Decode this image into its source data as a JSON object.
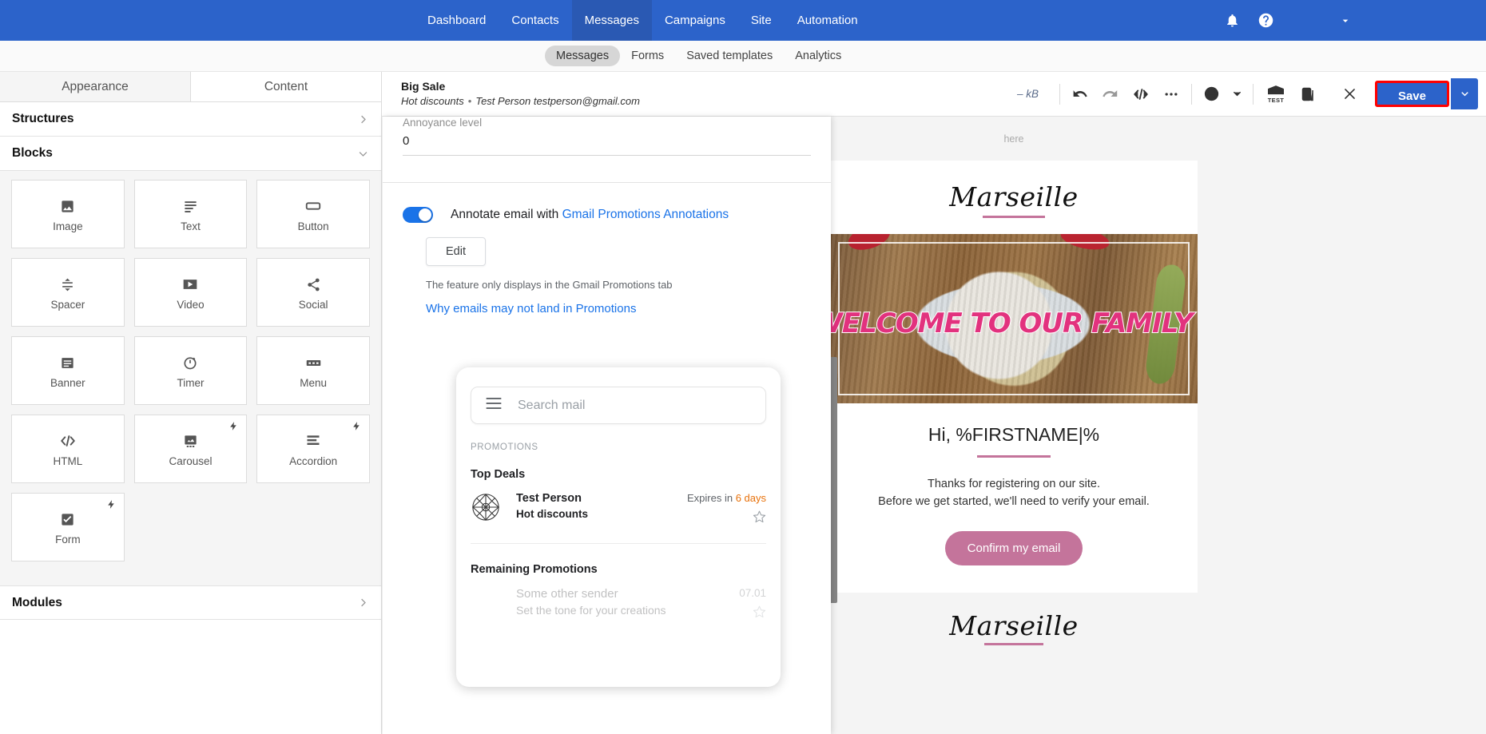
{
  "topnav": {
    "links": [
      {
        "label": "Dashboard",
        "active": false
      },
      {
        "label": "Contacts",
        "active": false
      },
      {
        "label": "Messages",
        "active": true
      },
      {
        "label": "Campaigns",
        "active": false
      },
      {
        "label": "Site",
        "active": false
      },
      {
        "label": "Automation",
        "active": false
      }
    ],
    "icons": [
      "bell-icon",
      "help-icon",
      "account-chevron-icon"
    ]
  },
  "subnav": {
    "tabs": [
      {
        "label": "Messages",
        "active": true
      },
      {
        "label": "Forms",
        "active": false
      },
      {
        "label": "Saved templates",
        "active": false
      },
      {
        "label": "Analytics",
        "active": false
      }
    ]
  },
  "sidebar": {
    "tabs": [
      {
        "label": "Appearance",
        "active": true
      },
      {
        "label": "Content",
        "active": false
      }
    ],
    "sections": [
      {
        "title": "Structures",
        "expanded": false
      },
      {
        "title": "Blocks",
        "expanded": true
      },
      {
        "title": "Modules",
        "expanded": false
      }
    ],
    "blocks": [
      {
        "label": "Image",
        "icon": "image-icon",
        "pro": false
      },
      {
        "label": "Text",
        "icon": "text-icon",
        "pro": false
      },
      {
        "label": "Button",
        "icon": "button-icon",
        "pro": false
      },
      {
        "label": "Spacer",
        "icon": "spacer-icon",
        "pro": false
      },
      {
        "label": "Video",
        "icon": "video-icon",
        "pro": false
      },
      {
        "label": "Social",
        "icon": "share-icon",
        "pro": false
      },
      {
        "label": "Banner",
        "icon": "banner-icon",
        "pro": false
      },
      {
        "label": "Timer",
        "icon": "timer-icon",
        "pro": false
      },
      {
        "label": "Menu",
        "icon": "menu-icon",
        "pro": false
      },
      {
        "label": "HTML",
        "icon": "code-icon",
        "pro": false
      },
      {
        "label": "Carousel",
        "icon": "carousel-icon",
        "pro": true
      },
      {
        "label": "Accordion",
        "icon": "accordion-icon",
        "pro": true
      },
      {
        "label": "Form",
        "icon": "checkbox-icon",
        "pro": true
      }
    ]
  },
  "editor_header": {
    "title": "Big Sale",
    "subject": "Hot discounts",
    "separator": "•",
    "recipient": "Test Person testperson@gmail.com",
    "size": "– kB",
    "toolbar_icons": [
      "undo-icon",
      "redo-icon",
      "code-view-icon",
      "more-icon",
      "globe-icon",
      "globe-chevron-icon",
      "test-send-icon",
      "duplicate-icon"
    ],
    "close_label": "×",
    "save_label": "Save",
    "save_caret": "save-options-chevron-icon",
    "test_badge": "TEST"
  },
  "panel": {
    "annoyance_label": "Annoyance level",
    "annoyance_value": "0",
    "toggle_on": true,
    "annotate_text": "Annotate email with ",
    "annotate_link": "Gmail Promotions Annotations",
    "edit_label": "Edit",
    "hint": "The feature only displays in the Gmail Promotions tab",
    "why_link": "Why emails may not land in Promotions"
  },
  "gmail_preview": {
    "search_placeholder": "Search mail",
    "hamburger": "hamburger-icon",
    "section_label": "PROMOTIONS",
    "top_deals_title": "Top Deals",
    "top_deal": {
      "name": "Test Person",
      "snippet": "Hot discounts",
      "expires_prefix": "Expires in ",
      "expires_value": "6 days"
    },
    "remaining_title": "Remaining Promotions",
    "remaining_item": {
      "name": "Some other sender",
      "snippet": "Set the tone for your creations",
      "date": "07.01"
    }
  },
  "email_preview": {
    "preheader": "here",
    "brand": "Marseille",
    "hero_text": "WELCOME TO OUR FAMILY",
    "greeting": "Hi, %FIRSTNAME|%",
    "paragraph_line1": "Thanks for registering on our site.",
    "paragraph_line2": "Before we get started, we'll need to verify your email.",
    "cta_label": "Confirm my email",
    "footer_brand": "Marseille"
  },
  "colors": {
    "brand_blue": "#2c63ca",
    "link_blue": "#1a73e8",
    "accent_pink": "#c4749b",
    "hero_pink": "#e2327e",
    "orange": "#e8710a",
    "highlight_red": "#ff0000"
  }
}
